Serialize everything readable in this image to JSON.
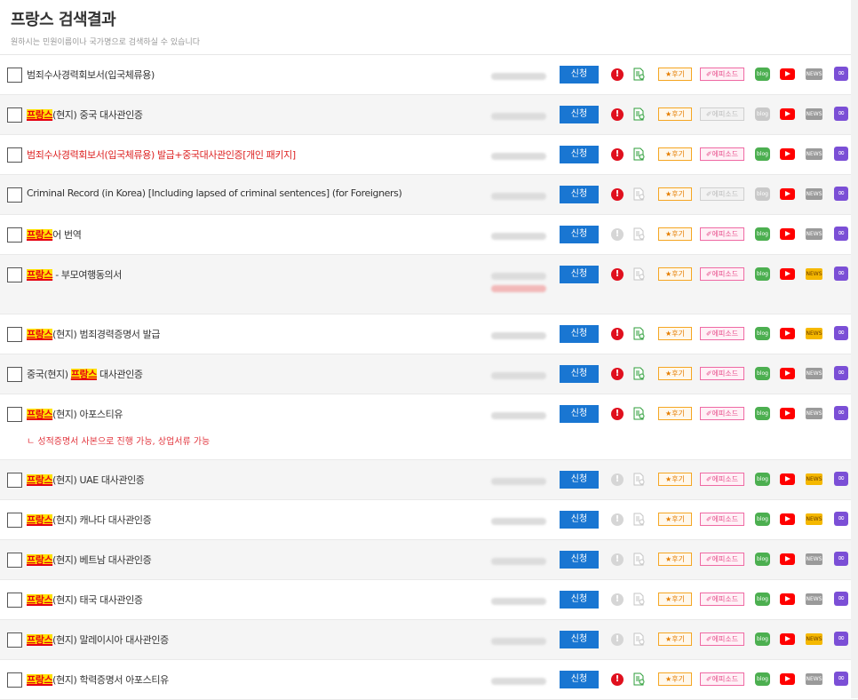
{
  "page": {
    "title": "프랑스 검색결과",
    "subtitle": "원하시는 민원이름이나 국가명으로 검색하실 수 있습니다"
  },
  "labels": {
    "apply": "신청",
    "review": "★후기",
    "episode": "✐에피소드",
    "blog": "blog",
    "news": "NEWS",
    "alert": "!",
    "link": "∞"
  },
  "rows": [
    {
      "parts": [
        {
          "text": "범죄수사경력회보서(입국체류용)",
          "hl": false
        }
      ],
      "red": false,
      "note": "",
      "alert": true,
      "doc": true,
      "episode": true,
      "blog": true,
      "news": false
    },
    {
      "parts": [
        {
          "text": "프랑스",
          "hl": true
        },
        {
          "text": "(현지) 중국 대사관인증",
          "hl": false
        }
      ],
      "red": false,
      "note": "",
      "alert": true,
      "doc": true,
      "episode": false,
      "blog": false,
      "news": false
    },
    {
      "parts": [
        {
          "text": "범죄수사경력회보서(입국체류용) 발급+중국대사관인증[개인 패키지]",
          "hl": false
        }
      ],
      "red": true,
      "note": "",
      "alert": true,
      "doc": true,
      "episode": true,
      "blog": true,
      "news": false
    },
    {
      "parts": [
        {
          "text": "Criminal Record (in Korea) [Including lapsed of criminal sentences] (for Foreigners)",
          "hl": false
        }
      ],
      "red": false,
      "note": "",
      "alert": true,
      "doc": false,
      "episode": false,
      "blog": false,
      "news": false
    },
    {
      "parts": [
        {
          "text": "프랑스",
          "hl": true
        },
        {
          "text": "어 번역",
          "hl": false
        }
      ],
      "red": false,
      "note": "",
      "alert": false,
      "doc": false,
      "episode": true,
      "blog": true,
      "news": false
    },
    {
      "parts": [
        {
          "text": "프랑스",
          "hl": true
        },
        {
          "text": " - 부모여행동의서",
          "hl": false
        }
      ],
      "red": false,
      "note": "",
      "alert": true,
      "doc": false,
      "episode": true,
      "blog": true,
      "news": true
    },
    {
      "parts": [
        {
          "text": "프랑스",
          "hl": true
        },
        {
          "text": "(현지) 범죄경력증명서 발급",
          "hl": false
        }
      ],
      "red": false,
      "note": "",
      "alert": true,
      "doc": true,
      "episode": true,
      "blog": true,
      "news": true
    },
    {
      "parts": [
        {
          "text": "중국(현지) ",
          "hl": false
        },
        {
          "text": "프랑스",
          "hl": true
        },
        {
          "text": " 대사관인증",
          "hl": false
        }
      ],
      "red": false,
      "note": "",
      "alert": true,
      "doc": true,
      "episode": true,
      "blog": true,
      "news": false
    },
    {
      "parts": [
        {
          "text": "프랑스",
          "hl": true
        },
        {
          "text": "(현지) 아포스티유",
          "hl": false
        }
      ],
      "red": false,
      "note": "ㄴ 성적증명서 사본으로 진행 가능, 상업서류 가능",
      "alert": true,
      "doc": true,
      "episode": true,
      "blog": true,
      "news": false
    },
    {
      "parts": [
        {
          "text": "프랑스",
          "hl": true
        },
        {
          "text": "(현지) UAE 대사관인증",
          "hl": false
        }
      ],
      "red": false,
      "note": "",
      "alert": false,
      "doc": false,
      "episode": true,
      "blog": true,
      "news": true
    },
    {
      "parts": [
        {
          "text": "프랑스",
          "hl": true
        },
        {
          "text": "(현지) 캐나다 대사관인증",
          "hl": false
        }
      ],
      "red": false,
      "note": "",
      "alert": false,
      "doc": false,
      "episode": true,
      "blog": true,
      "news": true
    },
    {
      "parts": [
        {
          "text": "프랑스",
          "hl": true
        },
        {
          "text": "(현지) 베트남 대사관인증",
          "hl": false
        }
      ],
      "red": false,
      "note": "",
      "alert": false,
      "doc": false,
      "episode": true,
      "blog": true,
      "news": false
    },
    {
      "parts": [
        {
          "text": "프랑스",
          "hl": true
        },
        {
          "text": "(현지) 태국 대사관인증",
          "hl": false
        }
      ],
      "red": false,
      "note": "",
      "alert": false,
      "doc": false,
      "episode": true,
      "blog": true,
      "news": false
    },
    {
      "parts": [
        {
          "text": "프랑스",
          "hl": true
        },
        {
          "text": "(현지) 말레이시아 대사관인증",
          "hl": false
        }
      ],
      "red": false,
      "note": "",
      "alert": false,
      "doc": false,
      "episode": true,
      "blog": true,
      "news": true
    },
    {
      "parts": [
        {
          "text": "프랑스",
          "hl": true
        },
        {
          "text": "(현지) 학력증명서 아포스티유",
          "hl": false
        }
      ],
      "red": false,
      "note": "",
      "alert": true,
      "doc": true,
      "episode": true,
      "blog": true,
      "news": false
    }
  ]
}
